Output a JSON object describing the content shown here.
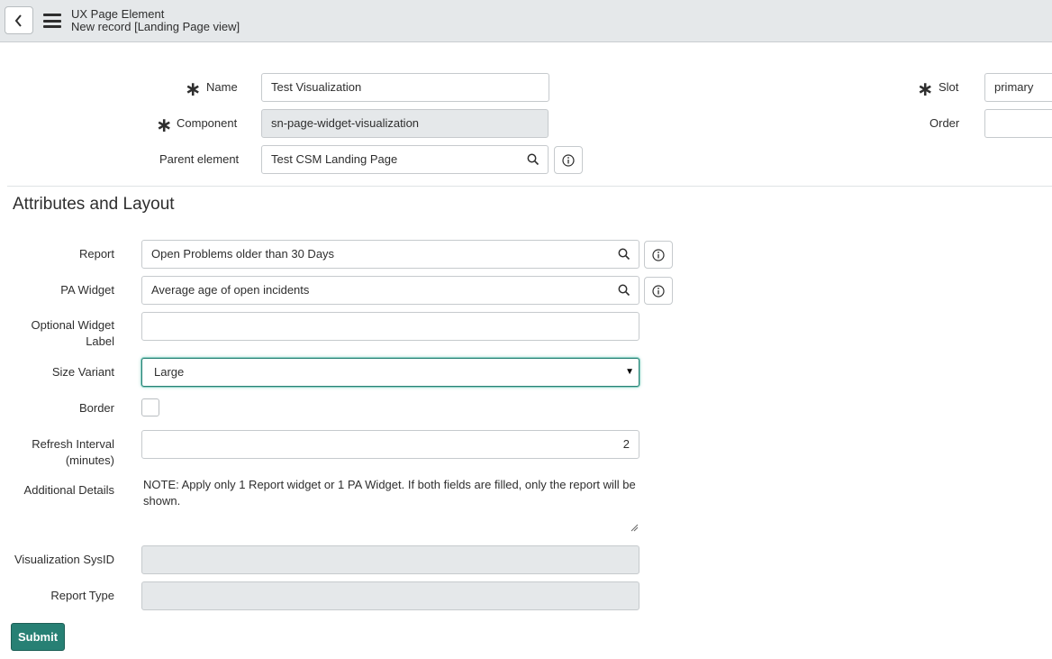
{
  "header": {
    "title": "UX Page Element",
    "subtitle": "New record [Landing Page view]"
  },
  "top_form": {
    "name": {
      "label": "Name",
      "value": "Test Visualization",
      "required": true
    },
    "component": {
      "label": "Component",
      "value": "sn-page-widget-visualization",
      "required": true,
      "readonly": true
    },
    "parent_element": {
      "label": "Parent element",
      "value": "Test  CSM Landing Page"
    },
    "slot": {
      "label": "Slot",
      "value": "primary",
      "required": true
    },
    "order": {
      "label": "Order",
      "value": ""
    }
  },
  "section": {
    "title": "Attributes and Layout"
  },
  "attributes": {
    "report": {
      "label": "Report",
      "value": "Open Problems older than 30 Days"
    },
    "pa_widget": {
      "label": "PA Widget",
      "value": "Average age of open incidents"
    },
    "optional_label": {
      "label_line1": "Optional Widget",
      "label_line2": "Label",
      "value": ""
    },
    "size_variant": {
      "label": "Size Variant",
      "value": "Large"
    },
    "border": {
      "label": "Border",
      "checked": false
    },
    "refresh_interval": {
      "label_line1": "Refresh Interval",
      "label_line2": "(minutes)",
      "value": "2"
    },
    "additional_details": {
      "label": "Additional Details",
      "value": "NOTE: Apply only 1 Report widget or 1 PA Widget. If both fields are filled, only the report will be shown."
    },
    "visualization_sysid": {
      "label": "Visualization SysID",
      "value": ""
    },
    "report_type": {
      "label": "Report Type",
      "value": ""
    }
  },
  "actions": {
    "submit_label": "Submit"
  },
  "icons": {
    "back": "chevron-left-icon",
    "menu": "hamburger-menu-icon",
    "required": "asterisk-icon",
    "lookup": "search-icon",
    "info": "info-icon",
    "dropdown": "caret-down-icon"
  },
  "colors": {
    "header_bg": "#e5e8ea",
    "primary": "#278074",
    "readonly_bg": "#e5e8ea"
  }
}
